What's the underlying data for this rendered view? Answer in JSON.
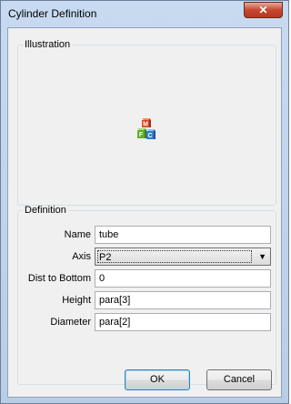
{
  "window": {
    "title": "Cylinder Definition",
    "close_glyph": "✕"
  },
  "illustration": {
    "legend": "Illustration",
    "logo_icon": "mfc-cubes-logo",
    "logo_letters": [
      "M",
      "F",
      "C"
    ]
  },
  "definition": {
    "legend": "Definition",
    "name": {
      "label": "Name",
      "value": "tube"
    },
    "axis": {
      "label": "Axis",
      "value": "P2"
    },
    "dist_to_bottom": {
      "label": "Dist to Bottom",
      "value": "0"
    },
    "height": {
      "label": "Height",
      "value": "para[3]"
    },
    "diameter": {
      "label": "Diameter",
      "value": "para[2]"
    }
  },
  "buttons": {
    "ok": "OK",
    "cancel": "Cancel"
  },
  "colors": {
    "close": "#c8462f",
    "frame": "#b9cde6"
  }
}
